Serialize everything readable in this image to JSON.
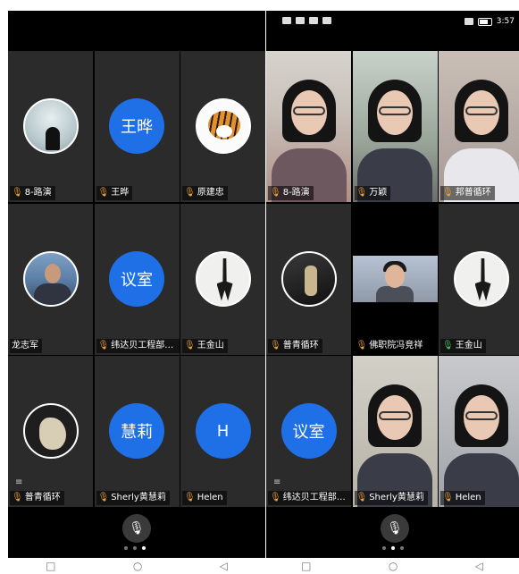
{
  "right_status": {
    "time": "3:57"
  },
  "left": {
    "tiles": [
      {
        "name": "8-路演",
        "type": "avatar",
        "style": "snow"
      },
      {
        "name": "王晔",
        "type": "text",
        "avatar_text": "王晔"
      },
      {
        "name": "原建忠",
        "type": "avatar",
        "style": "tiger"
      },
      {
        "name": "龙志军",
        "type": "avatar",
        "style": "man",
        "no_mic": true
      },
      {
        "name": "纬达贝工程部会...",
        "type": "text",
        "avatar_text": "议室"
      },
      {
        "name": "王金山",
        "type": "avatar",
        "style": "anchor"
      },
      {
        "name": "普青循环",
        "type": "avatar",
        "style": "cat",
        "list_icon": true
      },
      {
        "name": "Sherly黄慧莉",
        "type": "text",
        "avatar_text": "慧莉"
      },
      {
        "name": "Helen",
        "type": "text",
        "avatar_text": "H"
      }
    ],
    "page_dots": [
      false,
      false,
      true
    ]
  },
  "right": {
    "tiles": [
      {
        "name": "8-路演",
        "type": "video",
        "variant": "v1",
        "mic": "orange"
      },
      {
        "name": "万颖",
        "type": "video",
        "variant": "v2",
        "mic": "orange"
      },
      {
        "name": "邦普循环",
        "type": "video",
        "variant": "v3",
        "mic": "orange"
      },
      {
        "name": "普青循环",
        "type": "avatar",
        "style": "bird",
        "mic": "orange"
      },
      {
        "name": "佛职院冯竞祥",
        "type": "mini",
        "mic": "orange"
      },
      {
        "name": "王金山",
        "type": "avatar",
        "style": "anchor",
        "mic": "green"
      },
      {
        "name": "纬达贝工程部会...",
        "type": "text",
        "avatar_text": "议室",
        "mic": "orange",
        "list_icon": true
      },
      {
        "name": "Sherly黄慧莉",
        "type": "video",
        "variant": "v4",
        "mic": "orange"
      },
      {
        "name": "Helen",
        "type": "video",
        "variant": "v5",
        "mic": "orange"
      }
    ],
    "page_dots": [
      false,
      true,
      false
    ]
  },
  "icons": {
    "mic": "microphone-icon",
    "nav_back": "back-triangle-icon",
    "nav_home": "home-circle-icon",
    "nav_recent": "recent-square-icon"
  },
  "colors": {
    "avatar_blue": "#1f6fe6",
    "mic_orange": "#f0a23a",
    "mic_green": "#4cc46a"
  }
}
